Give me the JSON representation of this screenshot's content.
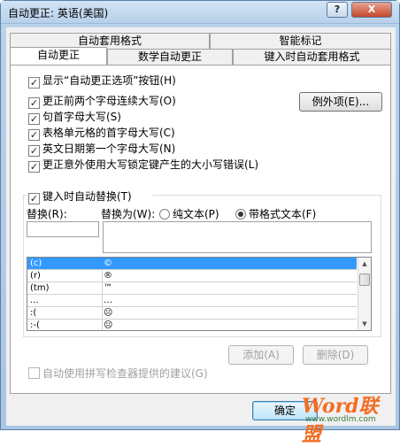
{
  "window": {
    "title": "自动更正: 英语(美国)",
    "help_label": "?",
    "close_label": "X"
  },
  "tabs": {
    "row1": [
      "自动套用格式",
      "智能标记"
    ],
    "row2": [
      "自动更正",
      "数学自动更正",
      "键入时自动套用格式"
    ]
  },
  "options": {
    "show_buttons": "显示“自动更正选项”按钮(H)",
    "correct_two_initials": "更正前两个字母连续大写(O)",
    "capitalize_sentences": "句首字母大写(S)",
    "capitalize_table_cells": "表格单元格的首字母大写(C)",
    "capitalize_days": "英文日期第一个字母大写(N)",
    "correct_caps_lock": "更正意外使用大写锁定键产生的大小写错误(L)",
    "exceptions_button": "例外项(E)..."
  },
  "replace_section": {
    "checkbox": "键入时自动替换(T)",
    "replace_label": "替换(R):",
    "with_label": "替换为(W):",
    "plain_text": "纯文本(P)",
    "formatted_text": "带格式文本(F)",
    "replace_value": "",
    "with_value": ""
  },
  "list": {
    "rows": [
      {
        "from": "(c)",
        "to": "©"
      },
      {
        "from": "(r)",
        "to": "®"
      },
      {
        "from": "(tm)",
        "to": "™"
      },
      {
        "from": "...",
        "to": "…"
      },
      {
        "from": ":(",
        "to": "☹"
      },
      {
        "from": ":-(",
        "to": "☹"
      }
    ]
  },
  "actions": {
    "add_button": "添加(A)",
    "delete_button": "删除(D)",
    "spell_suggest": "自动使用拼写检查器提供的建议(G)",
    "ok_button": "确定"
  },
  "watermark": {
    "brand": "Word联盟",
    "url": "www.wordlm.com"
  },
  "colors": {
    "selection": "#3399ff",
    "title_bar": "#b7d0ea",
    "close_button": "#c6472b",
    "watermark": "#f36c21"
  }
}
